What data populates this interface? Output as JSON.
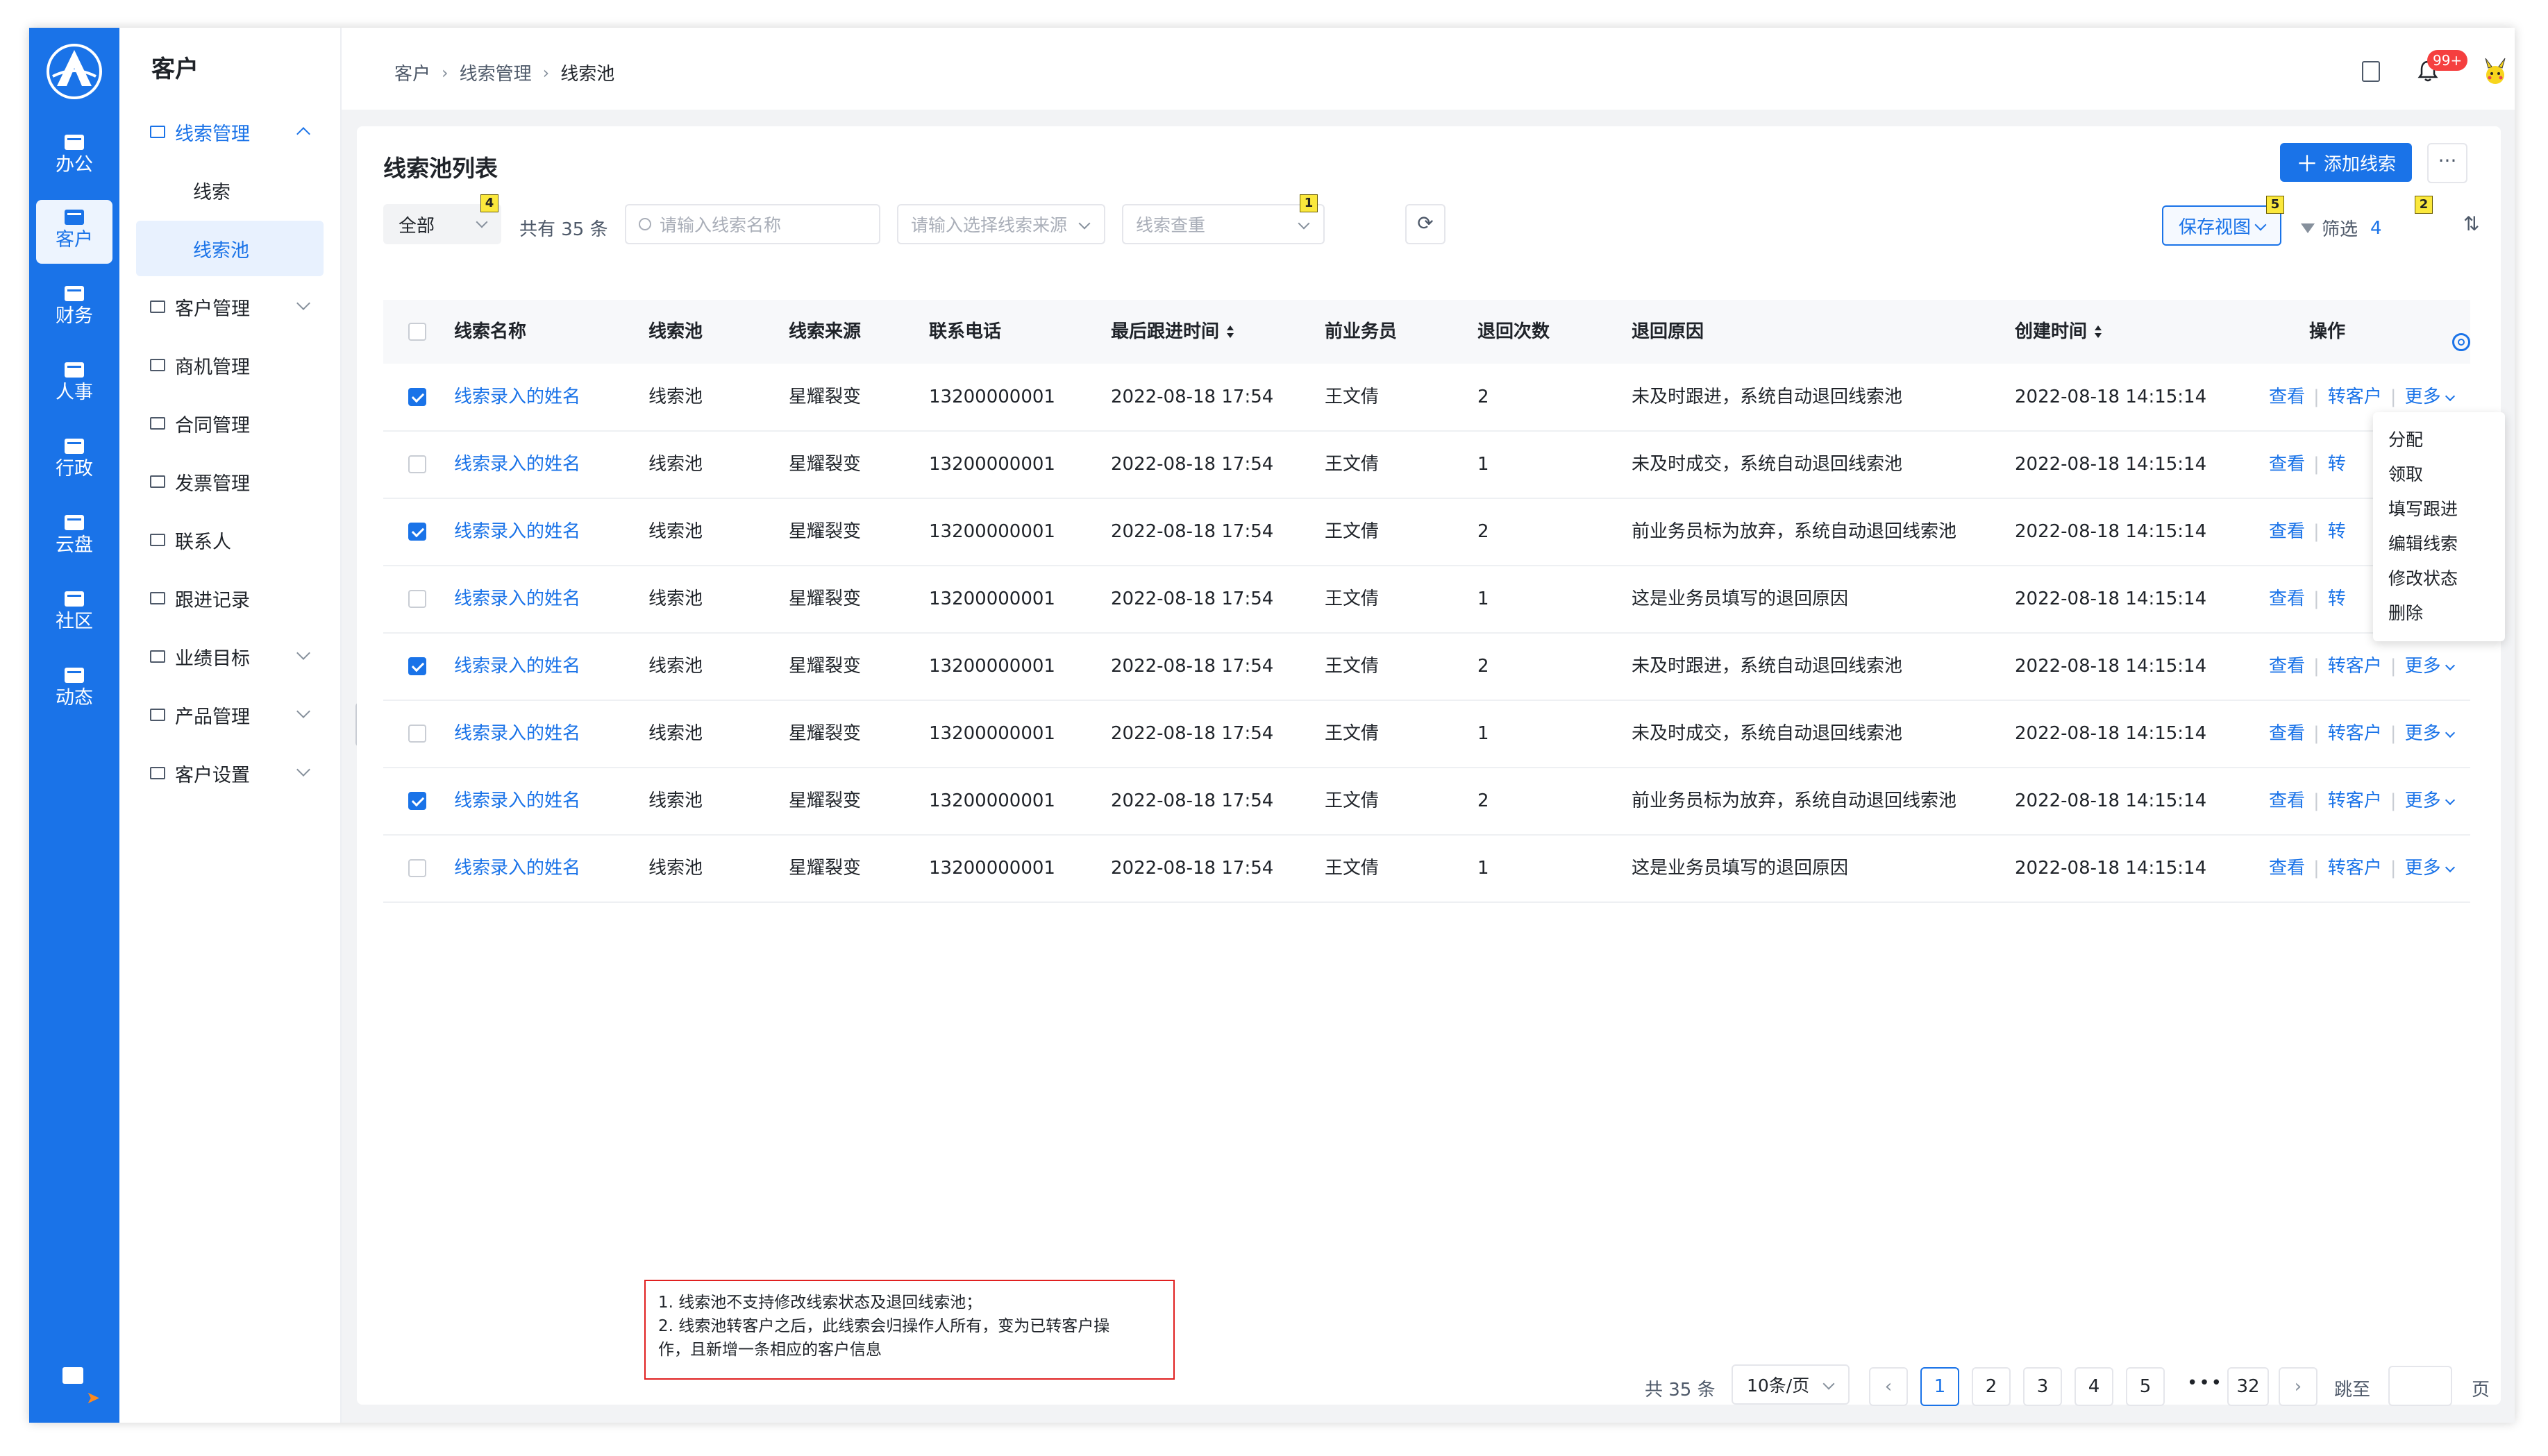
{
  "rail": {
    "items": [
      {
        "label": "办公",
        "active": false
      },
      {
        "label": "客户",
        "active": true
      },
      {
        "label": "财务",
        "active": false
      },
      {
        "label": "人事",
        "active": false
      },
      {
        "label": "行政",
        "active": false
      },
      {
        "label": "云盘",
        "active": false
      },
      {
        "label": "社区",
        "active": false
      },
      {
        "label": "动态",
        "active": false
      }
    ]
  },
  "sidebar": {
    "title": "客户",
    "menu": [
      {
        "label": "线索管理",
        "expanded": true
      },
      {
        "label": "线索",
        "sub": true
      },
      {
        "label": "线索池",
        "sub": true,
        "active": true
      },
      {
        "label": "客户管理",
        "chevron": true
      },
      {
        "label": "商机管理"
      },
      {
        "label": "合同管理"
      },
      {
        "label": "发票管理"
      },
      {
        "label": "联系人"
      },
      {
        "label": "跟进记录"
      },
      {
        "label": "业绩目标",
        "chevron": true
      },
      {
        "label": "产品管理",
        "chevron": true
      },
      {
        "label": "客户设置",
        "chevron": true
      }
    ]
  },
  "header": {
    "breadcrumb": [
      "客户",
      "线索管理",
      "线索池"
    ],
    "badge": "99+"
  },
  "card": {
    "title": "线索池列表",
    "add_button": "添加线索",
    "more_button": "···",
    "scope_select": "全部",
    "total_text": "共有 35 条",
    "name_search_placeholder": "请输入线索名称",
    "source_placeholder": "请输入选择线索来源",
    "dedupe_placeholder": "线索查重",
    "save_view": "保存视图",
    "filter_label": "筛选",
    "filter_count": "4",
    "sort_icon_text": "⇅"
  },
  "markers": {
    "scope": "4",
    "dedupe": "1",
    "save_view": "5",
    "filter": "2"
  },
  "table": {
    "columns": [
      "线索名称",
      "线索池",
      "线索来源",
      "联系电话",
      "最后跟进时间",
      "前业务员",
      "退回次数",
      "退回原因",
      "创建时间",
      "操作"
    ],
    "rows": [
      {
        "checked": true,
        "name": "线索录入的姓名",
        "pool": "线索池",
        "source": "星耀裂变",
        "phone": "13200000001",
        "last": "2022-08-18 17:54",
        "owner": "王文倩",
        "returns": "2",
        "reason": "未及时跟进，系统自动退回线索池",
        "created": "2022-08-18 14:15:14"
      },
      {
        "checked": false,
        "name": "线索录入的姓名",
        "pool": "线索池",
        "source": "星耀裂变",
        "phone": "13200000001",
        "last": "2022-08-18 17:54",
        "owner": "王文倩",
        "returns": "1",
        "reason": "未及时成交，系统自动退回线索池",
        "created": "2022-08-18 14:15:14"
      },
      {
        "checked": true,
        "name": "线索录入的姓名",
        "pool": "线索池",
        "source": "星耀裂变",
        "phone": "13200000001",
        "last": "2022-08-18 17:54",
        "owner": "王文倩",
        "returns": "2",
        "reason": "前业务员标为放弃，系统自动退回线索池",
        "created": "2022-08-18 14:15:14"
      },
      {
        "checked": false,
        "name": "线索录入的姓名",
        "pool": "线索池",
        "source": "星耀裂变",
        "phone": "13200000001",
        "last": "2022-08-18 17:54",
        "owner": "王文倩",
        "returns": "1",
        "reason": "这是业务员填写的退回原因",
        "created": "2022-08-18 14:15:14"
      },
      {
        "checked": true,
        "name": "线索录入的姓名",
        "pool": "线索池",
        "source": "星耀裂变",
        "phone": "13200000001",
        "last": "2022-08-18 17:54",
        "owner": "王文倩",
        "returns": "2",
        "reason": "未及时跟进，系统自动退回线索池",
        "created": "2022-08-18 14:15:14"
      },
      {
        "checked": false,
        "name": "线索录入的姓名",
        "pool": "线索池",
        "source": "星耀裂变",
        "phone": "13200000001",
        "last": "2022-08-18 17:54",
        "owner": "王文倩",
        "returns": "1",
        "reason": "未及时成交，系统自动退回线索池",
        "created": "2022-08-18 14:15:14"
      },
      {
        "checked": true,
        "name": "线索录入的姓名",
        "pool": "线索池",
        "source": "星耀裂变",
        "phone": "13200000001",
        "last": "2022-08-18 17:54",
        "owner": "王文倩",
        "returns": "2",
        "reason": "前业务员标为放弃，系统自动退回线索池",
        "created": "2022-08-18 14:15:14"
      },
      {
        "checked": false,
        "name": "线索录入的姓名",
        "pool": "线索池",
        "source": "星耀裂变",
        "phone": "13200000001",
        "last": "2022-08-18 17:54",
        "owner": "王文倩",
        "returns": "1",
        "reason": "这是业务员填写的退回原因",
        "created": "2022-08-18 14:15:14"
      }
    ],
    "actions": {
      "view": "查看",
      "convert": "转客户",
      "convert_cut": "转",
      "more": "更多"
    }
  },
  "more_menu": [
    "分配",
    "领取",
    "填写跟进",
    "编辑线索",
    "修改状态",
    "删除"
  ],
  "note": [
    "1. 线索池不支持修改线索状态及退回线索池；",
    "2. 线索池转客户之后，此线索会归操作人所有，变为已转客户操",
    "作，且新增一条相应的客户信息"
  ],
  "pagination": {
    "total": "共 35 条",
    "page_size": "10条/页",
    "prev": "‹",
    "next": "›",
    "pages": [
      "1",
      "2",
      "3",
      "4",
      "5"
    ],
    "current": "1",
    "dots": "•••",
    "last": "32",
    "jump_label": "跳至",
    "page_label": "页"
  },
  "colors": {
    "primary": "#1a73e8",
    "danger": "#f53f3f",
    "note_border": "#e02020",
    "marker": "#fbe83c"
  }
}
